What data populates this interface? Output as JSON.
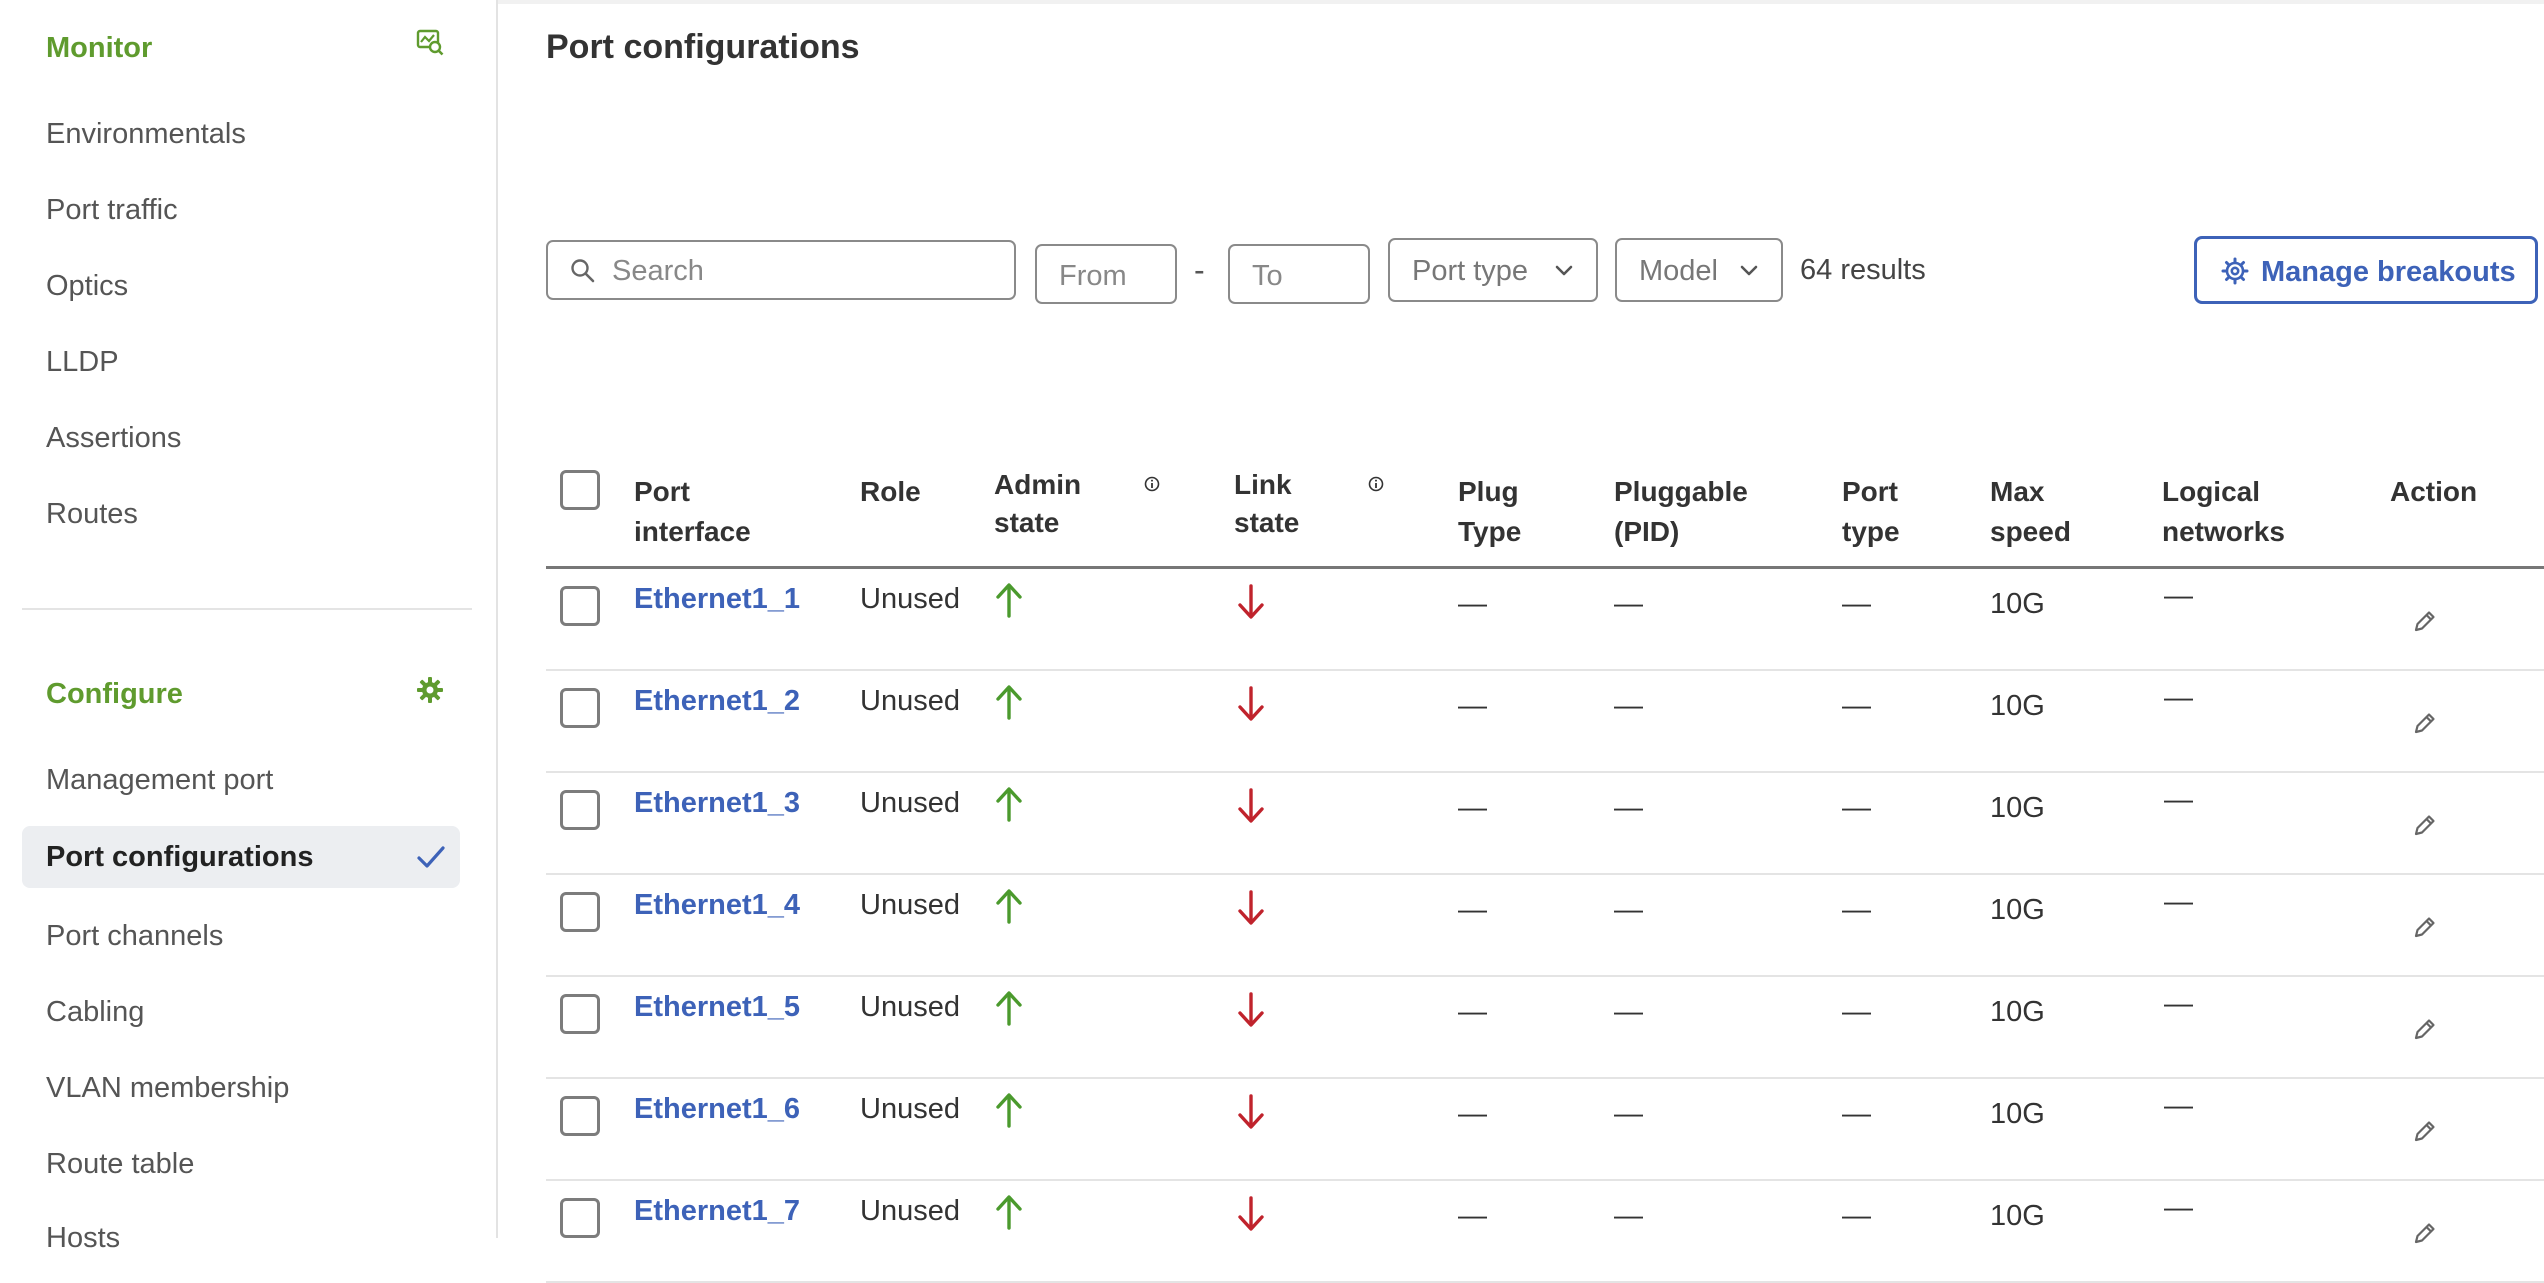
{
  "sidebar": {
    "monitor": {
      "title": "Monitor",
      "icon": "chart-search-icon",
      "items": [
        "Environmentals",
        "Port traffic",
        "Optics",
        "LLDP",
        "Assertions",
        "Routes"
      ]
    },
    "configure": {
      "title": "Configure",
      "icon": "gear-icon",
      "items": [
        "Management port",
        "Port configurations",
        "Port channels",
        "Cabling",
        "VLAN membership",
        "Route table",
        "Hosts"
      ],
      "active_index": 1
    }
  },
  "main": {
    "title": "Port configurations",
    "filters": {
      "search_placeholder": "Search",
      "from_placeholder": "From",
      "to_placeholder": "To",
      "range_separator": "-",
      "port_type_label": "Port type",
      "model_label": "Model",
      "results_count": "64 results",
      "manage_breakouts_label": "Manage breakouts"
    },
    "table": {
      "columns": [
        "Port interface",
        "Role",
        "Admin state",
        "Link state",
        "Plug Type",
        "Pluggable (PID)",
        "Port type",
        "Max speed",
        "Logical networks",
        "Action"
      ],
      "rows": [
        {
          "port": "Ethernet1_1",
          "role": "Unused",
          "admin": "up",
          "link": "down",
          "plug_type": "—",
          "pid": "—",
          "port_type": "—",
          "max_speed": "10G",
          "logical": "—"
        },
        {
          "port": "Ethernet1_2",
          "role": "Unused",
          "admin": "up",
          "link": "down",
          "plug_type": "—",
          "pid": "—",
          "port_type": "—",
          "max_speed": "10G",
          "logical": "—"
        },
        {
          "port": "Ethernet1_3",
          "role": "Unused",
          "admin": "up",
          "link": "down",
          "plug_type": "—",
          "pid": "—",
          "port_type": "—",
          "max_speed": "10G",
          "logical": "—"
        },
        {
          "port": "Ethernet1_4",
          "role": "Unused",
          "admin": "up",
          "link": "down",
          "plug_type": "—",
          "pid": "—",
          "port_type": "—",
          "max_speed": "10G",
          "logical": "—"
        },
        {
          "port": "Ethernet1_5",
          "role": "Unused",
          "admin": "up",
          "link": "down",
          "plug_type": "—",
          "pid": "—",
          "port_type": "—",
          "max_speed": "10G",
          "logical": "—"
        },
        {
          "port": "Ethernet1_6",
          "role": "Unused",
          "admin": "up",
          "link": "down",
          "plug_type": "—",
          "pid": "—",
          "port_type": "—",
          "max_speed": "10G",
          "logical": "—"
        },
        {
          "port": "Ethernet1_7",
          "role": "Unused",
          "admin": "up",
          "link": "down",
          "plug_type": "—",
          "pid": "—",
          "port_type": "—",
          "max_speed": "10G",
          "logical": "—"
        }
      ]
    }
  },
  "colors": {
    "accent_green": "#5f9b2e",
    "link_blue": "#3d62b8",
    "arrow_up": "#4b9a2d",
    "arrow_down": "#c0232c"
  }
}
